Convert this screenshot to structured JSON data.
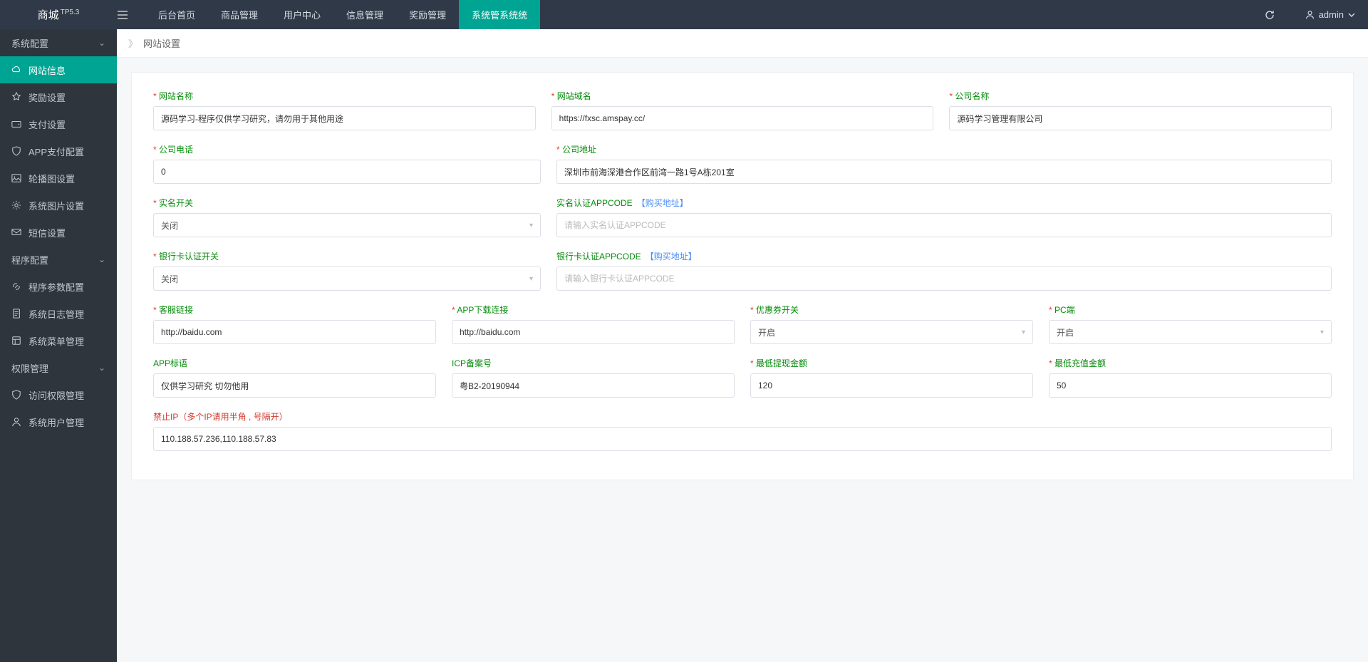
{
  "brand": {
    "name": "商城",
    "version": "TP5.3"
  },
  "topnav": [
    "后台首页",
    "商品管理",
    "用户中心",
    "信息管理",
    "奖励管理",
    "系统管系统统"
  ],
  "topnav_active": 5,
  "user": "admin",
  "sidebar": {
    "group1": "系统配置",
    "items1": [
      {
        "icon": "cloud",
        "label": "网站信息",
        "active": true
      },
      {
        "icon": "star",
        "label": "奖励设置"
      },
      {
        "icon": "wallet",
        "label": "支付设置"
      },
      {
        "icon": "shield",
        "label": "APP支付配置"
      },
      {
        "icon": "image",
        "label": "轮播图设置"
      },
      {
        "icon": "gear",
        "label": "系统图片设置"
      },
      {
        "icon": "msg",
        "label": "短信设置"
      }
    ],
    "group2": "程序配置",
    "items2": [
      {
        "icon": "link",
        "label": "程序参数配置"
      },
      {
        "icon": "log",
        "label": "系统日志管理"
      },
      {
        "icon": "menu",
        "label": "系统菜单管理"
      }
    ],
    "group3": "权限管理",
    "items3": [
      {
        "icon": "shield",
        "label": "访问权限管理"
      },
      {
        "icon": "user",
        "label": "系统用户管理"
      }
    ]
  },
  "breadcrumb": "网站设置",
  "form": {
    "site_name": {
      "label": "网站名称",
      "value": "源码学习-程序仅供学习研究，请勿用于其他用途"
    },
    "site_domain": {
      "label": "网站域名",
      "value": "https://fxsc.amspay.cc/"
    },
    "company_name": {
      "label": "公司名称",
      "value": "源码学习管理有限公司"
    },
    "company_phone": {
      "label": "公司电话",
      "value": "0"
    },
    "company_addr": {
      "label": "公司地址",
      "value": "深圳市前海深港合作区前湾一路1号A栋201室"
    },
    "realname_switch": {
      "label": "实名开关",
      "value": "关闭"
    },
    "realname_appcode": {
      "label": "实名认证APPCODE",
      "link": "【购买地址】",
      "placeholder": "请输入实名认证APPCODE",
      "value": ""
    },
    "bank_switch": {
      "label": "银行卡认证开关",
      "value": "关闭"
    },
    "bank_appcode": {
      "label": "银行卡认证APPCODE",
      "link": "【购买地址】",
      "placeholder": "请输入银行卡认证APPCODE",
      "value": ""
    },
    "service_url": {
      "label": "客服链接",
      "value": "http://baidu.com"
    },
    "app_download": {
      "label": "APP下载连接",
      "value": "http://baidu.com"
    },
    "coupon_switch": {
      "label": "优惠券开关",
      "value": "开启"
    },
    "pc_switch": {
      "label": "PC端",
      "value": "开启"
    },
    "app_slogan": {
      "label": "APP标语",
      "value": "仅供学习研究 切勿他用"
    },
    "icp": {
      "label": "ICP备案号",
      "value": "粤B2-20190944"
    },
    "min_withdraw": {
      "label": "最低提现金额",
      "value": "120"
    },
    "min_recharge": {
      "label": "最低充值金额",
      "value": "50"
    },
    "ban_ip": {
      "label": "禁止IP",
      "note": "（多个IP请用半角 , 号隔开）",
      "value": "110.188.57.236,110.188.57.83"
    }
  }
}
